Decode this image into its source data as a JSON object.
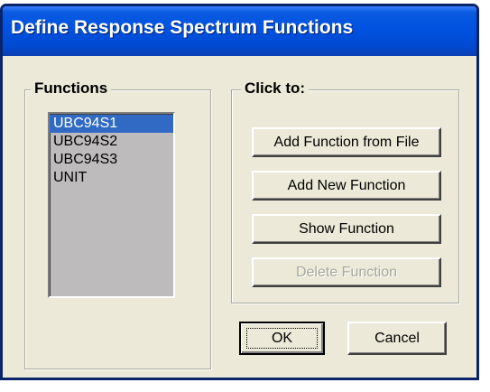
{
  "window": {
    "title": "Define Response Spectrum Functions"
  },
  "functions_group": {
    "label": "Functions",
    "items": [
      "UBC94S1",
      "UBC94S2",
      "UBC94S3",
      "UNIT"
    ],
    "selected_index": 0
  },
  "click_group": {
    "label": "Click to:",
    "buttons": {
      "add_from_file": "Add Function from File",
      "add_new": "Add New Function",
      "show": "Show Function",
      "delete": "Delete Function"
    }
  },
  "dialog_buttons": {
    "ok": "OK",
    "cancel": "Cancel"
  },
  "colors": {
    "titlebar": "#0052e0",
    "dialog_face": "#ece9d8",
    "selection": "#316ac5",
    "listbox_bg": "#bdbbbb"
  }
}
